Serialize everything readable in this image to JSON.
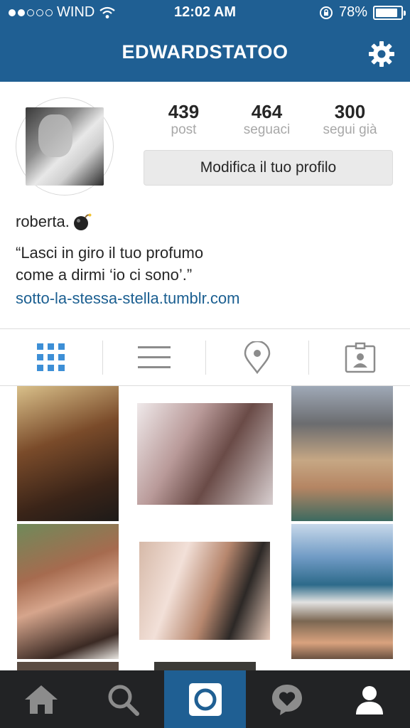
{
  "status_bar": {
    "carrier": "WIND",
    "time": "12:02 AM",
    "battery": "78%",
    "signal_bars_filled": 2,
    "signal_bars_total": 5
  },
  "nav": {
    "title": "EDWARDSTATOO",
    "settings_icon": "gear-icon"
  },
  "profile": {
    "stats": [
      {
        "value": "439",
        "label": "post"
      },
      {
        "value": "464",
        "label": "seguaci"
      },
      {
        "value": "300",
        "label": "segui già"
      }
    ],
    "edit_button": "Modifica il tuo profilo",
    "name": "roberta.",
    "bio_line1": "“Lasci in giro il tuo profumo",
    "bio_line2": "come a dirmi ‘io ci sono’.”",
    "website": "sotto-la-stessa-stella.tumblr.com"
  },
  "tabs": [
    {
      "icon": "grid-icon",
      "active": true
    },
    {
      "icon": "list-icon",
      "active": false
    },
    {
      "icon": "location-pin-icon",
      "active": false
    },
    {
      "icon": "tagged-photos-icon",
      "active": false
    }
  ],
  "bottom_nav": [
    {
      "icon": "home-icon"
    },
    {
      "icon": "search-icon"
    },
    {
      "icon": "camera-icon",
      "active": true
    },
    {
      "icon": "activity-heart-icon"
    },
    {
      "icon": "profile-icon"
    }
  ],
  "colors": {
    "brand_blue": "#1f5f93",
    "link_blue": "#1b5f91",
    "active_tab_blue": "#3d8fd6",
    "bottom_bar": "#222325"
  }
}
